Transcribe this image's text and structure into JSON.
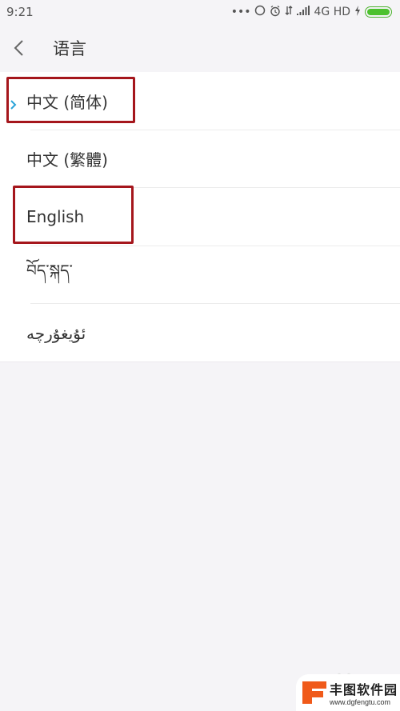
{
  "status_bar": {
    "time": "9:21",
    "icons": [
      "more-dots-icon",
      "sync-icon",
      "alarm-icon",
      "data-transfer-icon",
      "signal-icon"
    ],
    "network": "4G HD",
    "battery_charging": true,
    "battery_color": "#4cc12e"
  },
  "header": {
    "back_icon": "chevron-left-icon",
    "title": "语言"
  },
  "languages": [
    {
      "label": "中文 (简体)",
      "selected": true
    },
    {
      "label": "中文 (繁體)",
      "selected": false
    },
    {
      "label": "English",
      "selected": false
    },
    {
      "label": "བོད་སྐད་",
      "selected": false
    },
    {
      "label": "ئۇيغۇرچە",
      "selected": false
    }
  ],
  "selected_marker_color": "#2aa3d8",
  "annotation_color": "#a5161c",
  "watermark": {
    "brand": "丰图软件园",
    "url": "www.dgfengtu.com"
  }
}
